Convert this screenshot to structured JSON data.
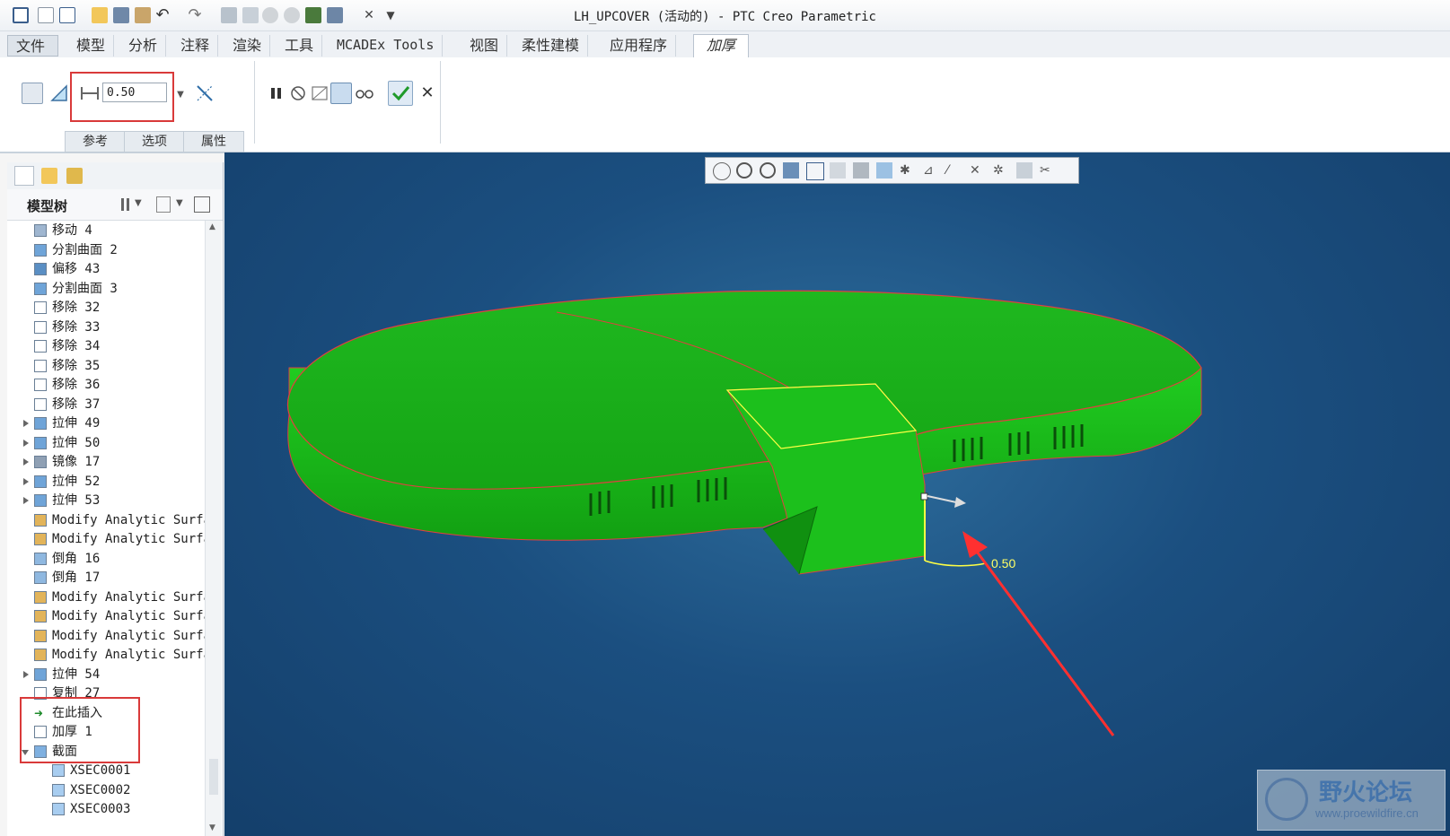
{
  "window": {
    "title": "LH_UPCOVER (活动的) - PTC Creo Parametric"
  },
  "colors": {
    "model_green": "#19c419",
    "edge_red": "#e04040",
    "highlight_red": "#d93a3a",
    "viewport_bg": "#1b4f80",
    "annotation_yellow": "#ffff44"
  },
  "menu": {
    "tabs": [
      "文件",
      "模型",
      "分析",
      "注释",
      "渲染",
      "工具",
      "MCADEx Tools",
      "视图",
      "柔性建模",
      "应用程序",
      "加厚"
    ],
    "active_tab": "加厚"
  },
  "ribbon": {
    "thickness_value": "0.50",
    "sub_tabs": [
      "参考",
      "选项",
      "属性"
    ],
    "icons": [
      "solid-icon",
      "surface-icon",
      "dimension-icon",
      "flip-direction-icon",
      "pause-icon",
      "no-preview-icon",
      "check-model-icon",
      "verify-icon",
      "glasses-icon",
      "ok-check-icon",
      "cancel-x-icon"
    ]
  },
  "model_tree": {
    "header": "模型树",
    "items": [
      {
        "label": "移动 4",
        "expandable": false,
        "icon": "move-icon"
      },
      {
        "label": "分割曲面 2",
        "expandable": false,
        "icon": "split-surface-icon"
      },
      {
        "label": "偏移 43",
        "expandable": false,
        "icon": "offset-icon"
      },
      {
        "label": "分割曲面 3",
        "expandable": false,
        "icon": "split-surface-icon"
      },
      {
        "label": "移除 32",
        "expandable": false,
        "icon": "remove-icon"
      },
      {
        "label": "移除 33",
        "expandable": false,
        "icon": "remove-icon"
      },
      {
        "label": "移除 34",
        "expandable": false,
        "icon": "remove-icon"
      },
      {
        "label": "移除 35",
        "expandable": false,
        "icon": "remove-icon"
      },
      {
        "label": "移除 36",
        "expandable": false,
        "icon": "remove-icon"
      },
      {
        "label": "移除 37",
        "expandable": false,
        "icon": "remove-icon"
      },
      {
        "label": "拉伸 49",
        "expandable": true,
        "icon": "extrude-icon"
      },
      {
        "label": "拉伸 50",
        "expandable": true,
        "icon": "extrude-icon"
      },
      {
        "label": "镜像 17",
        "expandable": true,
        "icon": "mirror-icon"
      },
      {
        "label": "拉伸 52",
        "expandable": true,
        "icon": "extrude-icon"
      },
      {
        "label": "拉伸 53",
        "expandable": true,
        "icon": "extrude-icon"
      },
      {
        "label": "Modify Analytic Surfa",
        "expandable": false,
        "icon": "modify-surface-icon"
      },
      {
        "label": "Modify Analytic Surfa",
        "expandable": false,
        "icon": "modify-surface-icon"
      },
      {
        "label": "倒角 16",
        "expandable": false,
        "icon": "chamfer-icon"
      },
      {
        "label": "倒角 17",
        "expandable": false,
        "icon": "chamfer-icon"
      },
      {
        "label": "Modify Analytic Surfa",
        "expandable": false,
        "icon": "modify-surface-icon"
      },
      {
        "label": "Modify Analytic Surfa",
        "expandable": false,
        "icon": "modify-surface-icon"
      },
      {
        "label": "Modify Analytic Surfa",
        "expandable": false,
        "icon": "modify-surface-icon"
      },
      {
        "label": "Modify Analytic Surfa",
        "expandable": false,
        "icon": "modify-surface-icon"
      },
      {
        "label": "拉伸 54",
        "expandable": true,
        "icon": "extrude-icon"
      },
      {
        "label": "复制 27",
        "expandable": false,
        "icon": "copy-icon"
      },
      {
        "label": "在此插入",
        "expandable": false,
        "icon": "insert-here-icon"
      },
      {
        "label": "加厚 1",
        "expandable": false,
        "icon": "thicken-icon"
      },
      {
        "label": "截面",
        "expandable": "open",
        "icon": "section-folder-icon"
      },
      {
        "label": "XSEC0001",
        "expandable": false,
        "icon": "xsec-icon",
        "indent": 1
      },
      {
        "label": "XSEC0002",
        "expandable": false,
        "icon": "xsec-icon",
        "indent": 1
      },
      {
        "label": "XSEC0003",
        "expandable": false,
        "icon": "xsec-icon",
        "indent": 1
      }
    ]
  },
  "viewport": {
    "dimension_label": "0.50"
  },
  "watermark": {
    "name": "野火论坛",
    "url": "www.proewildfire.cn"
  }
}
